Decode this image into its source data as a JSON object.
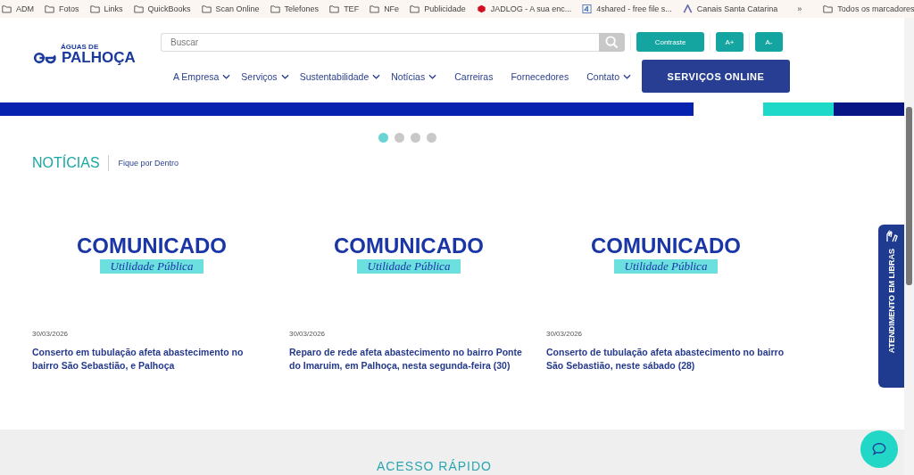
{
  "bookmarks": [
    {
      "label": "ADM",
      "kind": "folder"
    },
    {
      "label": "Fotos",
      "kind": "folder"
    },
    {
      "label": "Links",
      "kind": "folder"
    },
    {
      "label": "QuickBooks",
      "kind": "folder"
    },
    {
      "label": "Scan Online",
      "kind": "folder"
    },
    {
      "label": "Telefones",
      "kind": "folder"
    },
    {
      "label": "TEF",
      "kind": "folder"
    },
    {
      "label": "NFe",
      "kind": "folder"
    },
    {
      "label": "Publicidade",
      "kind": "folder"
    },
    {
      "label": "JADLOG - A sua enc...",
      "kind": "cube"
    },
    {
      "label": "4shared - free file s...",
      "kind": "four"
    },
    {
      "label": "Canais Santa Catarina",
      "kind": "chevron"
    }
  ],
  "bookmarks_more": "»",
  "all_bookmarks": "Todos os marcadores",
  "logo": {
    "small": "ÁGUAS DE",
    "name": "PALHOÇA"
  },
  "search": {
    "placeholder": "Buscar"
  },
  "accessibility_buttons": [
    "Contraste",
    "A+",
    "A-"
  ],
  "nav": [
    {
      "label": "A Empresa",
      "dropdown": true
    },
    {
      "label": "Serviços",
      "dropdown": true
    },
    {
      "label": "Sustentabilidade",
      "dropdown": true
    },
    {
      "label": "Notícias",
      "dropdown": true
    },
    {
      "label": "Carreiras",
      "dropdown": false
    },
    {
      "label": "Fornecedores",
      "dropdown": false
    },
    {
      "label": "Contato",
      "dropdown": true
    }
  ],
  "online_button": "SERVIÇOS ONLINE",
  "carousel_dots": [
    {
      "selected": true
    },
    {
      "selected": false
    },
    {
      "selected": false
    },
    {
      "selected": false
    }
  ],
  "news": {
    "title": "NOTÍCIAS",
    "subtitle": "Fique por Dentro",
    "items": [
      {
        "headline": "COMUNICADO",
        "tag": "Utilidade Pública",
        "date": "30/03/2026",
        "title": "Conserto em tubulação afeta abastecimento no bairro São Sebastião, e Palhoça"
      },
      {
        "headline": "COMUNICADO",
        "tag": "Utilidade Pública",
        "date": "30/03/2026",
        "title": "Reparo de rede afeta abastecimento no bairro Ponte do Imaruim, em Palhoça, nesta segunda-feira (30)"
      },
      {
        "headline": "COMUNICADO",
        "tag": "Utilidade Pública",
        "date": "30/03/2026",
        "title": "Conserto de tubulação afeta abastecimento no bairro São Sebastião, neste sábado (28)"
      }
    ]
  },
  "libras_tab": "ATENDIMENTO EM LIBRAS",
  "quick_access": "ACESSO RÁPIDO"
}
